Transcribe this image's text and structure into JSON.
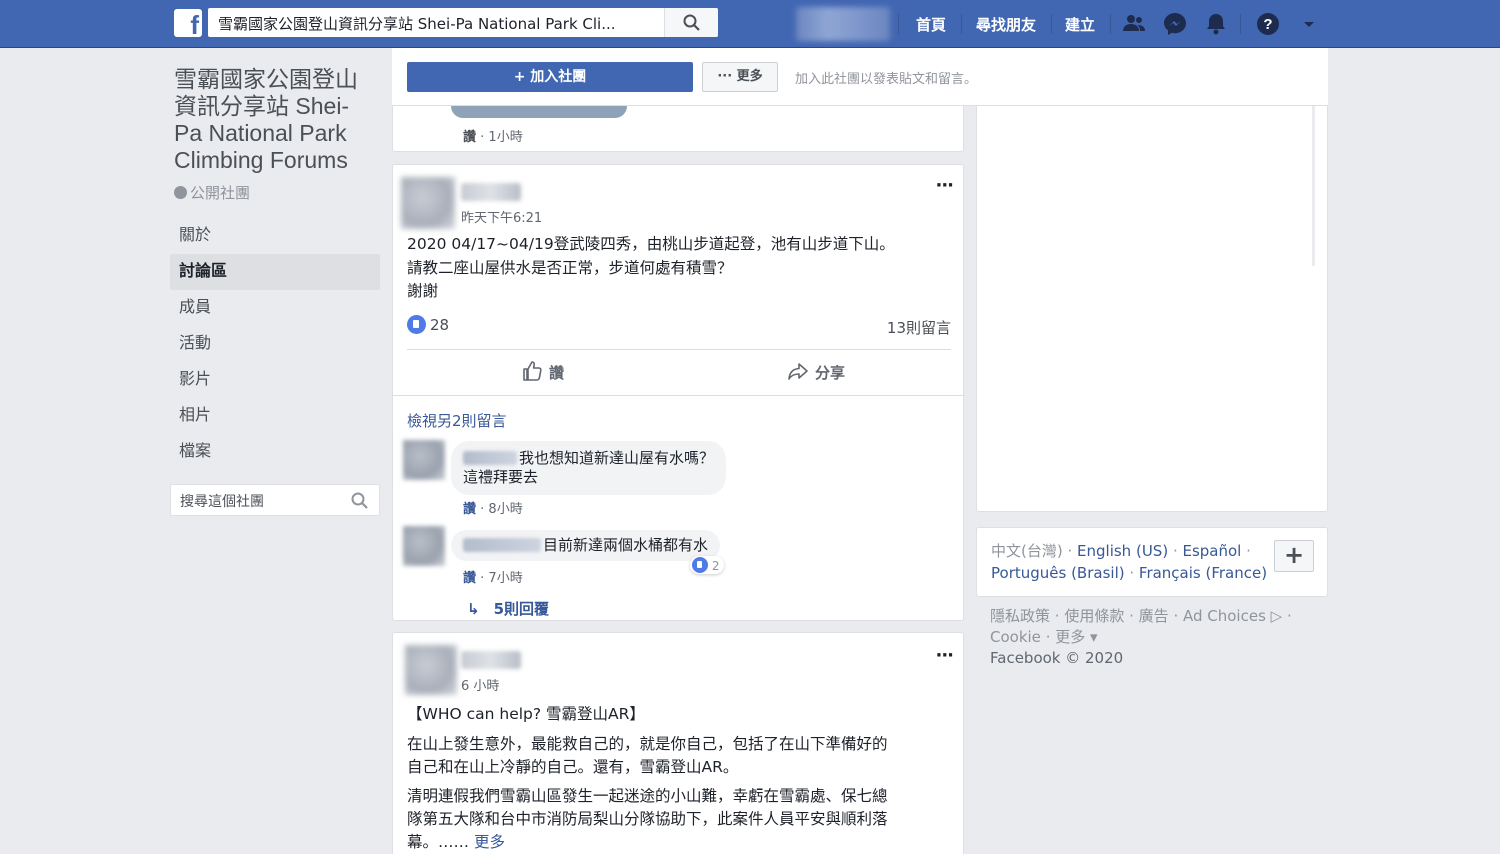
{
  "topbar": {
    "logo": "f",
    "search_value": "雪霸國家公園登山資訊分享站 Shei-Pa National Park Cli...",
    "nav": [
      "首頁",
      "尋找朋友",
      "建立"
    ],
    "icons": [
      "friend-requests-icon",
      "messenger-icon",
      "notifications-icon",
      "help-icon",
      "account-menu-icon"
    ],
    "brand_color": "#4267b2"
  },
  "group": {
    "title": "雪霸國家公園登山資訊分享站 Shei-Pa National Park Climbing Forums",
    "type": "公開社團"
  },
  "left_nav": {
    "items": [
      {
        "label": "關於",
        "active": false
      },
      {
        "label": "討論區",
        "active": true
      },
      {
        "label": "成員",
        "active": false
      },
      {
        "label": "活動",
        "active": false
      },
      {
        "label": "影片",
        "active": false
      },
      {
        "label": "相片",
        "active": false
      },
      {
        "label": "檔案",
        "active": false
      }
    ],
    "search_placeholder": "搜尋這個社團"
  },
  "action_bar": {
    "join_label": "+ 加入社團",
    "more_label": "··· 更多",
    "hint": "加入此社團以發表貼文和留言。"
  },
  "prev_post": {
    "like_link": "讚",
    "time": "· 1小時"
  },
  "post1": {
    "time": "昨天下午6:21",
    "lines": [
      "2020 04/17~04/19登武陵四秀，由桃山步道起登，池有山步道下山。",
      "請教二座山屋供水是否正常，步道何處有積雪？",
      "謝謝"
    ],
    "like_count": "28",
    "comment_count": "13則留言",
    "like_action": "讚",
    "share_action": "分享",
    "view_more": "檢視另2則留言",
    "comments": [
      {
        "text_line1": "我也想知道新達山屋有水嗎？",
        "text_line2": "這禮拜要去",
        "like_link": "讚",
        "time": "· 8小時"
      },
      {
        "text_line1": "目前新達兩個水桶都有水",
        "like_link": "讚",
        "time": "· 7小時",
        "reactions": "2"
      }
    ],
    "replies": "5則回覆"
  },
  "post2": {
    "time": "6 小時",
    "title": "【WHO can help? 雪霸登山AR】",
    "para1": [
      "在山上發生意外，最能救自己的，就是你自己，包括了在山下準備好的",
      "自己和在山上冷靜的自己。還有，雪霸登山AR。"
    ],
    "para2": [
      "清明連假我們雪霸山區發生一起迷途的小山難，幸虧在雪霸處、保七總",
      "隊第五大隊和台中市消防局梨山分隊協助下，此案件人員平安與順利落",
      "幕。……"
    ],
    "see_more": "更多"
  },
  "right": {
    "languages": {
      "current": "中文(台灣)",
      "others": [
        "English (US)",
        "Español",
        "Português (Brasil)",
        "Français (France)"
      ]
    },
    "plus": "+",
    "footer_links": [
      "隱私政策",
      "使用條款",
      "廣告",
      "Ad Choices",
      "Cookie",
      "更多"
    ],
    "copyright": "Facebook © 2020"
  }
}
